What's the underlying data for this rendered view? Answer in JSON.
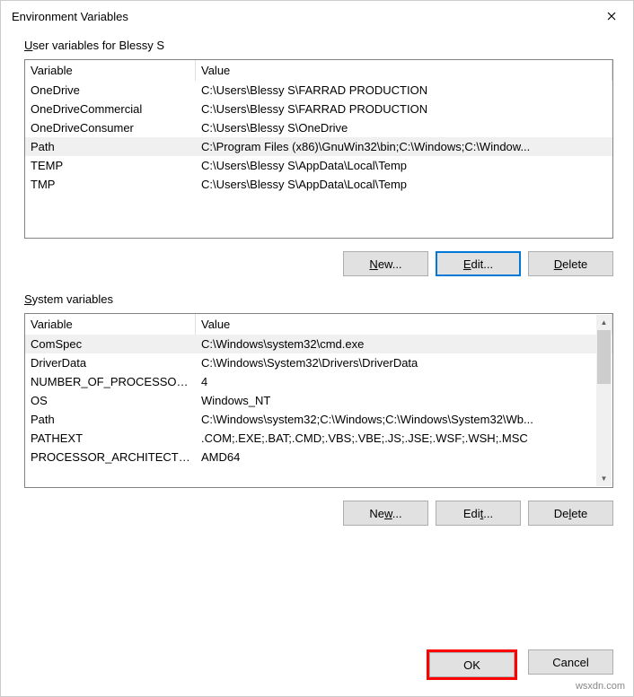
{
  "title": "Environment Variables",
  "user_section": {
    "label_prefix": "U",
    "label_rest": "ser variables for Blessy S",
    "columns": {
      "variable": "Variable",
      "value": "Value"
    },
    "rows": [
      {
        "variable": "OneDrive",
        "value": "C:\\Users\\Blessy S\\FARRAD PRODUCTION",
        "selected": false
      },
      {
        "variable": "OneDriveCommercial",
        "value": "C:\\Users\\Blessy S\\FARRAD PRODUCTION",
        "selected": false
      },
      {
        "variable": "OneDriveConsumer",
        "value": "C:\\Users\\Blessy S\\OneDrive",
        "selected": false
      },
      {
        "variable": "Path",
        "value": "C:\\Program Files (x86)\\GnuWin32\\bin;C:\\Windows;C:\\Window...",
        "selected": true
      },
      {
        "variable": "TEMP",
        "value": "C:\\Users\\Blessy S\\AppData\\Local\\Temp",
        "selected": false
      },
      {
        "variable": "TMP",
        "value": "C:\\Users\\Blessy S\\AppData\\Local\\Temp",
        "selected": false
      }
    ],
    "buttons": {
      "new_u": "N",
      "new_rest": "ew...",
      "edit_u": "E",
      "edit_rest": "dit...",
      "delete_u": "D",
      "delete_rest": "elete"
    }
  },
  "system_section": {
    "label_prefix": "S",
    "label_rest": "ystem variables",
    "columns": {
      "variable": "Variable",
      "value": "Value"
    },
    "rows": [
      {
        "variable": "ComSpec",
        "value": "C:\\Windows\\system32\\cmd.exe",
        "selected": true
      },
      {
        "variable": "DriverData",
        "value": "C:\\Windows\\System32\\Drivers\\DriverData",
        "selected": false
      },
      {
        "variable": "NUMBER_OF_PROCESSORS",
        "value": "4",
        "selected": false
      },
      {
        "variable": "OS",
        "value": "Windows_NT",
        "selected": false
      },
      {
        "variable": "Path",
        "value": "C:\\Windows\\system32;C:\\Windows;C:\\Windows\\System32\\Wb...",
        "selected": false
      },
      {
        "variable": "PATHEXT",
        "value": ".COM;.EXE;.BAT;.CMD;.VBS;.VBE;.JS;.JSE;.WSF;.WSH;.MSC",
        "selected": false
      },
      {
        "variable": "PROCESSOR_ARCHITECTU...",
        "value": "AMD64",
        "selected": false
      }
    ],
    "buttons": {
      "new_u": "w",
      "new_pre": "Ne",
      "new_rest": "...",
      "edit_u": "t",
      "edit_pre": "Edi",
      "edit_rest": "...",
      "delete_u": "l",
      "delete_pre": "De",
      "delete_rest": "ete"
    }
  },
  "footer": {
    "ok": "OK",
    "cancel": "Cancel"
  },
  "watermark": "wsxdn.com"
}
